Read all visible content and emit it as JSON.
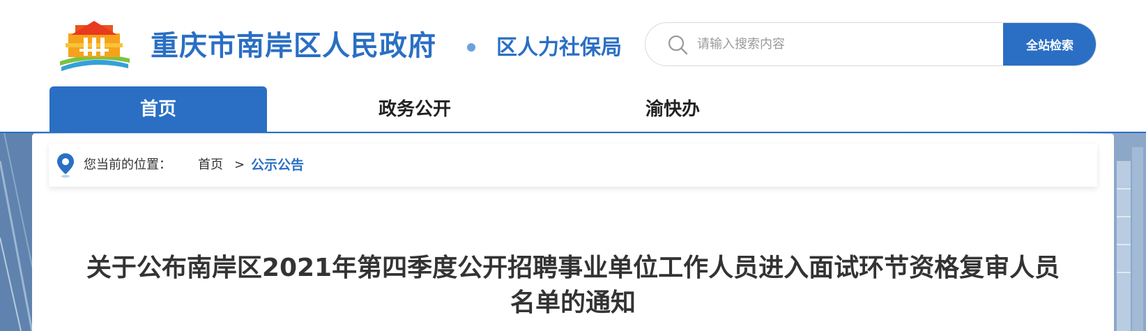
{
  "header": {
    "site_title": "重庆市南岸区人民政府",
    "dept_title": "区人力社保局",
    "logo_icon": "tiananmen-logo-icon"
  },
  "search": {
    "placeholder": "请输入搜索内容",
    "button_label": "全站检索",
    "icon": "search-icon"
  },
  "nav": {
    "items": [
      {
        "label": "首页",
        "active": true
      },
      {
        "label": "政务公开",
        "active": false
      },
      {
        "label": "渝快办",
        "active": false
      }
    ]
  },
  "breadcrumb": {
    "icon": "location-pin-icon",
    "label": "您当前的位置：",
    "home": "首页",
    "separator": ">",
    "current": "公示公告"
  },
  "article": {
    "title": "关于公布南岸区2021年第四季度公开招聘事业单位工作人员进入面试环节资格复审人员名单的通知"
  },
  "colors": {
    "brand_blue": "#2a6fc4",
    "text_dark": "#333333"
  }
}
